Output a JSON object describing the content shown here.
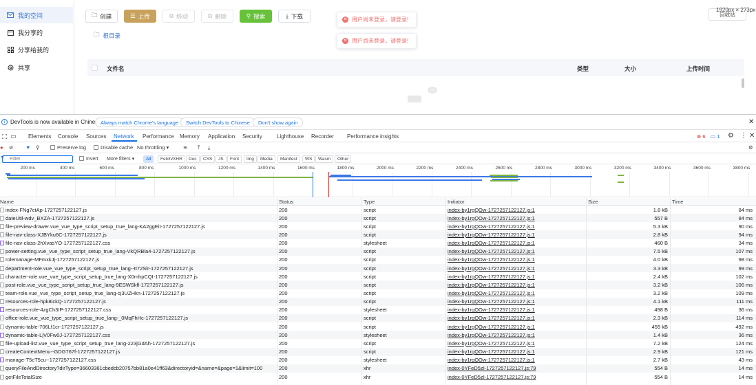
{
  "sidebar": {
    "items": [
      {
        "label": "我的空间",
        "icon": "mail-icon",
        "active": true
      },
      {
        "label": "我分享的",
        "icon": "calendar-icon",
        "active": false
      },
      {
        "label": "分享给我的",
        "icon": "grid-icon",
        "active": false
      },
      {
        "label": "共享",
        "icon": "gear-icon",
        "active": false
      }
    ]
  },
  "toolbar": {
    "create": "创建",
    "upload": "上传",
    "move": "移动",
    "delete": "删除",
    "search": "搜索",
    "download": "下载",
    "recycle": "回收站",
    "dimensions": "1920px × 273px"
  },
  "breadcrumb": {
    "root": "根目录"
  },
  "table": {
    "headers": {
      "name": "文件名",
      "type": "类型",
      "size": "大小",
      "uploaded": "上传时间"
    }
  },
  "toasts": [
    "用户尚未登录，请登录!",
    "用户尚未登录，请登录!"
  ],
  "colors": {
    "accent": "#3d7bd9",
    "upload": "#c8a25c",
    "search": "#67c23a",
    "error": "#f56c6c",
    "devtools_blue": "#1a73e8"
  },
  "devtools": {
    "infobar": {
      "message": "DevTools is now available in Chinese!",
      "btn_match": "Always match Chrome's language",
      "btn_switch": "Switch DevTools to Chinese",
      "btn_dont": "Don't show again"
    },
    "tabs": [
      "Elements",
      "Console",
      "Sources",
      "Network",
      "Performance",
      "Memory",
      "Application",
      "Security",
      "Lighthouse",
      "Recorder",
      "Performance insights"
    ],
    "active_tab": "Network",
    "errors": "6",
    "messages": "1",
    "controls": {
      "preserve_log": "Preserve log",
      "disable_cache": "Disable cache",
      "throttling": "No throttling"
    },
    "filter": {
      "placeholder": "Filter",
      "invert": "Invert",
      "more_filters": "More filters",
      "types": [
        "All",
        "Fetch/XHR",
        "Doc",
        "CSS",
        "JS",
        "Font",
        "Img",
        "Media",
        "Manifest",
        "WS",
        "Wasm",
        "Other"
      ]
    },
    "timeline": {
      "ticks": [
        "200 ms",
        "400 ms",
        "600 ms",
        "800 ms",
        "1000 ms",
        "1200 ms",
        "1400 ms",
        "1600 ms",
        "1800 ms",
        "2000 ms",
        "2200 ms",
        "2400 ms",
        "2600 ms",
        "2800 ms",
        "3000 ms",
        "3200 ms",
        "3400 ms",
        "3600 ms",
        "3800 ms"
      ]
    },
    "columns": {
      "name": "Name",
      "status": "Status",
      "type": "Type",
      "initiator": "Initiator",
      "size": "Size",
      "time": "Time"
    },
    "rows": [
      {
        "name": "index-FNg7ctAp-1727257122127.js",
        "status": "200",
        "type": "script",
        "initiator": "index-by1rgQOw-1727257122127.js:1",
        "size": "1.8 kB",
        "time": "84 ms",
        "kind": "js"
      },
      {
        "name": "dateUtil-wdv_BXZA-1727257122127.js",
        "status": "200",
        "type": "script",
        "initiator": "index-by1rgQOw-1727257122127.js:1",
        "size": "557 B",
        "time": "84 ms",
        "kind": "js"
      },
      {
        "name": "file-preview-drawer.vue_vue_type_script_setup_true_lang-KA2ggEit-1727257122127.js",
        "status": "200",
        "type": "script",
        "initiator": "index-by1rgQOw-1727257122127.js:1",
        "size": "5.3 kB",
        "time": "90 ms",
        "kind": "js"
      },
      {
        "name": "file-nav-class-XJBYku6C-1727257122127.js",
        "status": "200",
        "type": "script",
        "initiator": "index-by1rgQOw-1727257122127.js:1",
        "size": "2.8 kB",
        "time": "94 ms",
        "kind": "js"
      },
      {
        "name": "file-nav-class-2hXvasYO-1727257122127.css",
        "status": "200",
        "type": "stylesheet",
        "initiator": "index-by1rgQOw-1727257122127.js:1",
        "size": "460 B",
        "time": "34 ms",
        "kind": "css"
      },
      {
        "name": "power-setting.vue_vue_type_script_setup_true_lang-VkQRBla4-1727257122127.js",
        "status": "200",
        "type": "script",
        "initiator": "index-by1rgQOw-1727257122127.js:1",
        "size": "7.5 kB",
        "time": "107 ms",
        "kind": "js"
      },
      {
        "name": "rolemanage-MFmxkJj-1727257122127.js",
        "status": "200",
        "type": "script",
        "initiator": "index-by1rgQOw-1727257122127.js:1",
        "size": "4.0 kB",
        "time": "98 ms",
        "kind": "js"
      },
      {
        "name": "department-role.vue_vue_type_script_setup_true_lang--tt72Slr-1727257122127.js",
        "status": "200",
        "type": "script",
        "initiator": "index-by1rgQOw-1727257122127.js:1",
        "size": "3.3 kB",
        "time": "99 ms",
        "kind": "js"
      },
      {
        "name": "character-role.vue_vue_type_script_setup_true_lang-X0mhpCQI-1727257122127.js",
        "status": "200",
        "type": "script",
        "initiator": "index-by1rgQOw-1727257122127.js:1",
        "size": "2.4 kB",
        "time": "102 ms",
        "kind": "js"
      },
      {
        "name": "post-role.vue_vue_type_script_setup_true_lang-9ESWSkfl-1727257122127.js",
        "status": "200",
        "type": "script",
        "initiator": "index-by1rgQOw-1727257122127.js:1",
        "size": "3.2 kB",
        "time": "106 ms",
        "kind": "js"
      },
      {
        "name": "team-role.vue_vue_type_script_setup_true_lang-cj3UZHkn-1727257122127.js",
        "status": "200",
        "type": "script",
        "initiator": "index-by1rgQOw-1727257122127.js:1",
        "size": "3.2 kB",
        "time": "109 ms",
        "kind": "js"
      },
      {
        "name": "resources-role-hpk8ickQ-1727257122127.js",
        "status": "200",
        "type": "script",
        "initiator": "index-by1rgQOw-1727257122127.js:1",
        "size": "4.1 kB",
        "time": "111 ms",
        "kind": "js"
      },
      {
        "name": "resources-role-4zgCh3IP-1727257122127.css",
        "status": "200",
        "type": "stylesheet",
        "initiator": "index-by1rgQOw-1727257122127.js:1",
        "size": "498 B",
        "time": "36 ms",
        "kind": "css"
      },
      {
        "name": "office-role.vue_vue_type_script_setup_true_lang-_0MqFhHc-1727257122127.js",
        "status": "200",
        "type": "script",
        "initiator": "index-by1rgQOw-1727257122127.js:1",
        "size": "2.3 kB",
        "time": "114 ms",
        "kind": "js"
      },
      {
        "name": "dynamic-table-706Lf1cr-1727257122127.js",
        "status": "200",
        "type": "script",
        "initiator": "index-by1rgQOw-1727257122127.js:1",
        "size": "455 kB",
        "time": "492 ms",
        "kind": "js"
      },
      {
        "name": "dynamic-table-LjV0Fw0J-1727257122127.css",
        "status": "200",
        "type": "stylesheet",
        "initiator": "index-by1rgQOw-1727257122127.js:1",
        "size": "1.4 kB",
        "time": "36 ms",
        "kind": "css"
      },
      {
        "name": "file-upload-list.vue_vue_type_script_setup_true_lang-223jGdAh-1727257122127.js",
        "status": "200",
        "type": "script",
        "initiator": "index-by1rgQOw-1727257122127.js:1",
        "size": "7.2 kB",
        "time": "124 ms",
        "kind": "js"
      },
      {
        "name": "createContextMenu--GDG767f-1727257122127.js",
        "status": "200",
        "type": "script",
        "initiator": "index-by1rgQOw-1727257122127.js:1",
        "size": "2.9 kB",
        "time": "121 ms",
        "kind": "js"
      },
      {
        "name": "manage-T5cT5cu--1727257122127.css",
        "status": "200",
        "type": "stylesheet",
        "initiator": "index-by1rgQOw-1727257122127.js:1",
        "size": "2.7 kB",
        "time": "43 ms",
        "kind": "css"
      },
      {
        "name": "queryFileAndDirectory?dirType=36603361cbedcb20757bb81a0e41ff63&directoryid=&name=&page=1&limit=100",
        "status": "200",
        "type": "xhr",
        "initiator": "index-0YFeD5zI-1727257122127.js:79",
        "size": "554 B",
        "time": "14 ms",
        "kind": "xhr"
      },
      {
        "name": "getFileTotalSize",
        "status": "200",
        "type": "xhr",
        "initiator": "index-0YFeD5zI-1727257122127.js:79",
        "size": "554 B",
        "time": "14 ms",
        "kind": "xhr"
      }
    ]
  }
}
